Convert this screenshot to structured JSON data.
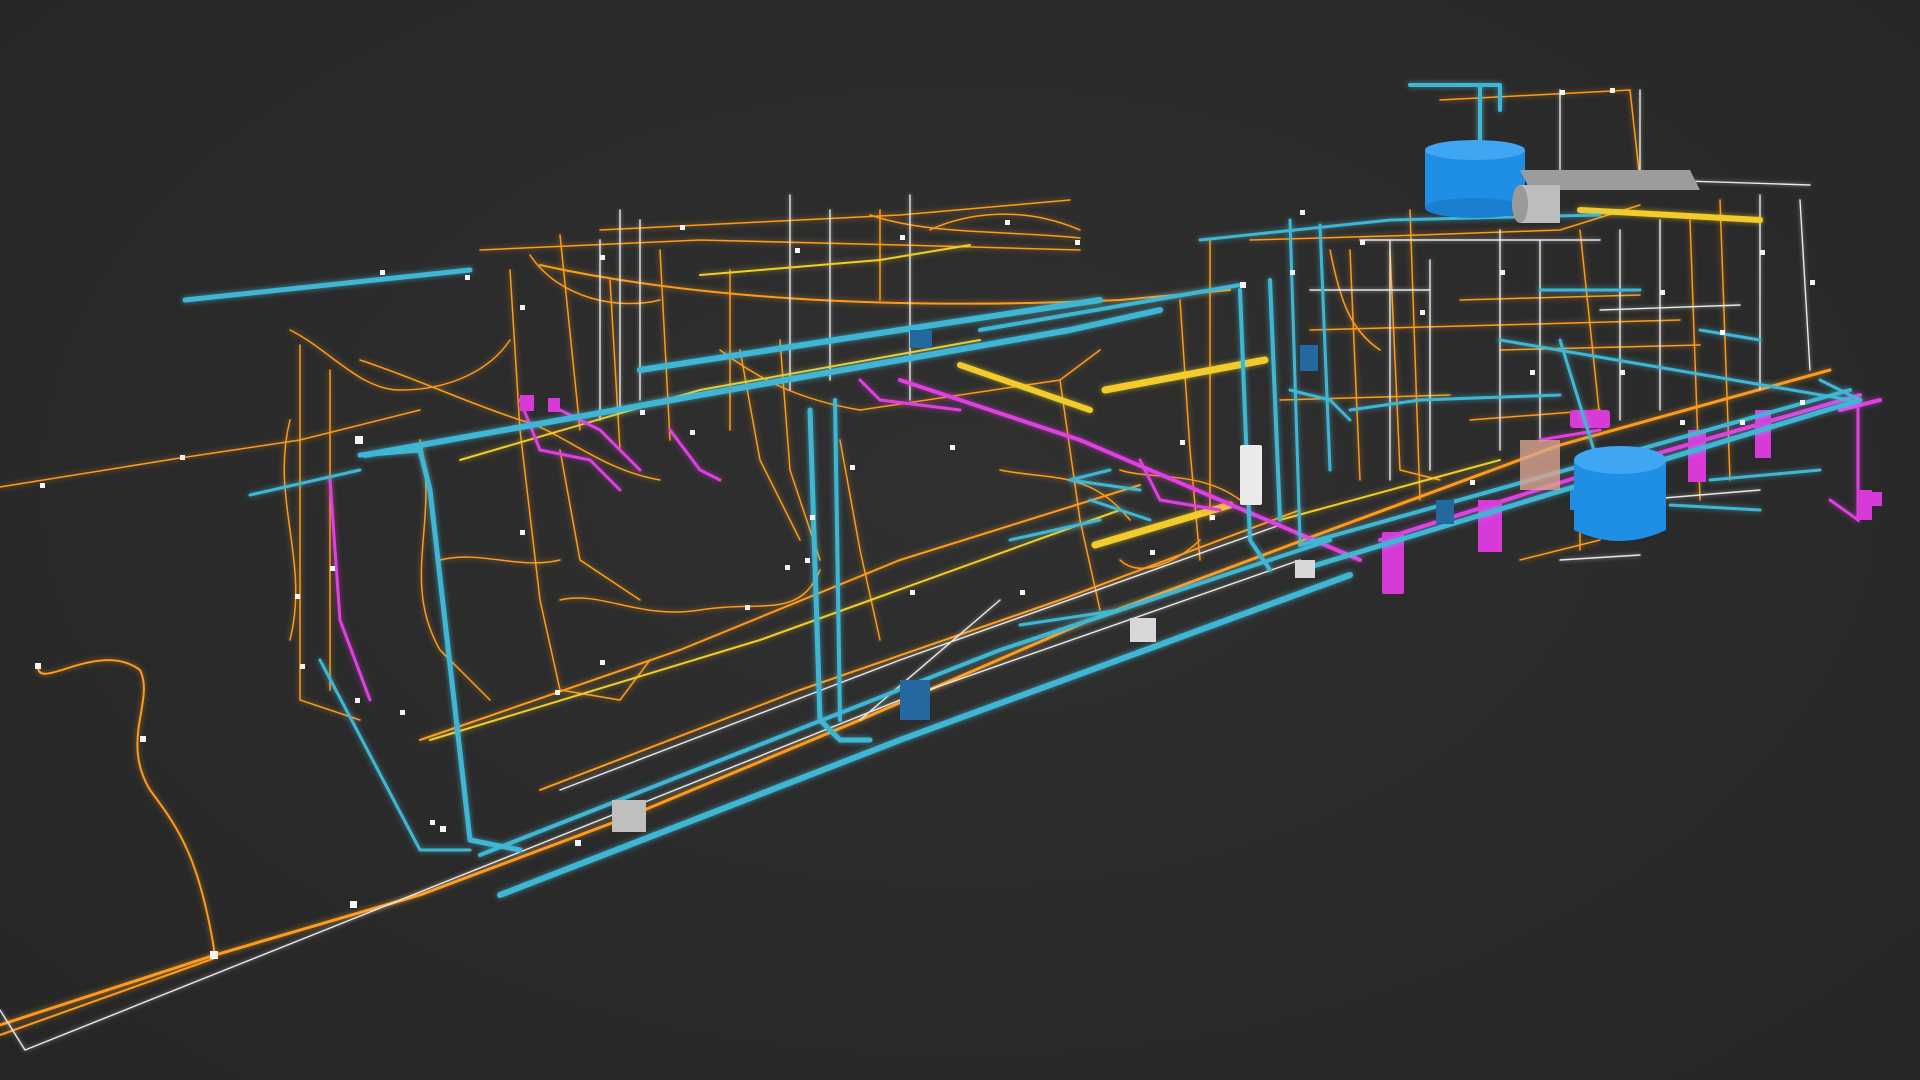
{
  "scene": {
    "colors": {
      "background": "#2b2b2b",
      "water_pipe": "#3fb7d4",
      "electrical": "#ff9a1a",
      "drainage": "#e040e0",
      "gas": "#f2cc2a",
      "low_voltage": "#e8e8e8",
      "tank": "#1f8fe6",
      "equipment": "#bdbdbd"
    },
    "systems": [
      "water-supply",
      "electrical-conduit",
      "drainage",
      "gas",
      "low-voltage",
      "water-tank",
      "equipment"
    ]
  }
}
